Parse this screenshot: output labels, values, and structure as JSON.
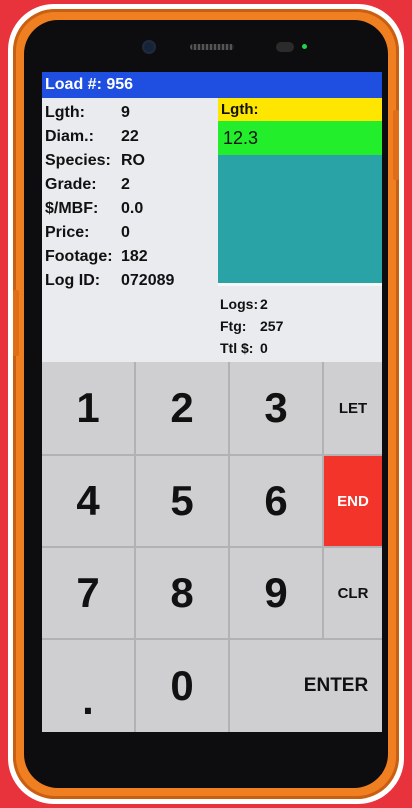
{
  "header": {
    "title": "Load #: 956"
  },
  "fields": [
    {
      "label": "Lgth:",
      "value": "9"
    },
    {
      "label": "Diam.:",
      "value": "22"
    },
    {
      "label": "Species:",
      "value": "RO"
    },
    {
      "label": "Grade:",
      "value": "2"
    },
    {
      "label": "$/MBF:",
      "value": "0.0"
    },
    {
      "label": "Price:",
      "value": "0"
    },
    {
      "label": "Footage:",
      "value": "182"
    },
    {
      "label": "Log ID:",
      "value": "072089"
    }
  ],
  "input_panel": {
    "label": "Lgth:",
    "value": "12.3"
  },
  "summary": {
    "logs_label": "Logs:",
    "logs_value": "2",
    "ftg_label": "Ftg:",
    "ftg_value": "257",
    "total_label": "Ttl $:",
    "total_value": "0"
  },
  "keypad": {
    "k1": "1",
    "k2": "2",
    "k3": "3",
    "let": "LET",
    "k4": "4",
    "k5": "5",
    "k6": "6",
    "end": "END",
    "k7": "7",
    "k8": "8",
    "k9": "9",
    "clr": "CLR",
    "dot": ".",
    "k0": "0",
    "enter": "ENTER"
  },
  "colors": {
    "title_bar": "#1f4fe0",
    "lgth_header": "#ffe600",
    "lgth_value": "#22ee2c",
    "display_area": "#2aa3a6",
    "end_key": "#f2342a",
    "phone_body": "#f07f22",
    "background": "#e8323c"
  }
}
